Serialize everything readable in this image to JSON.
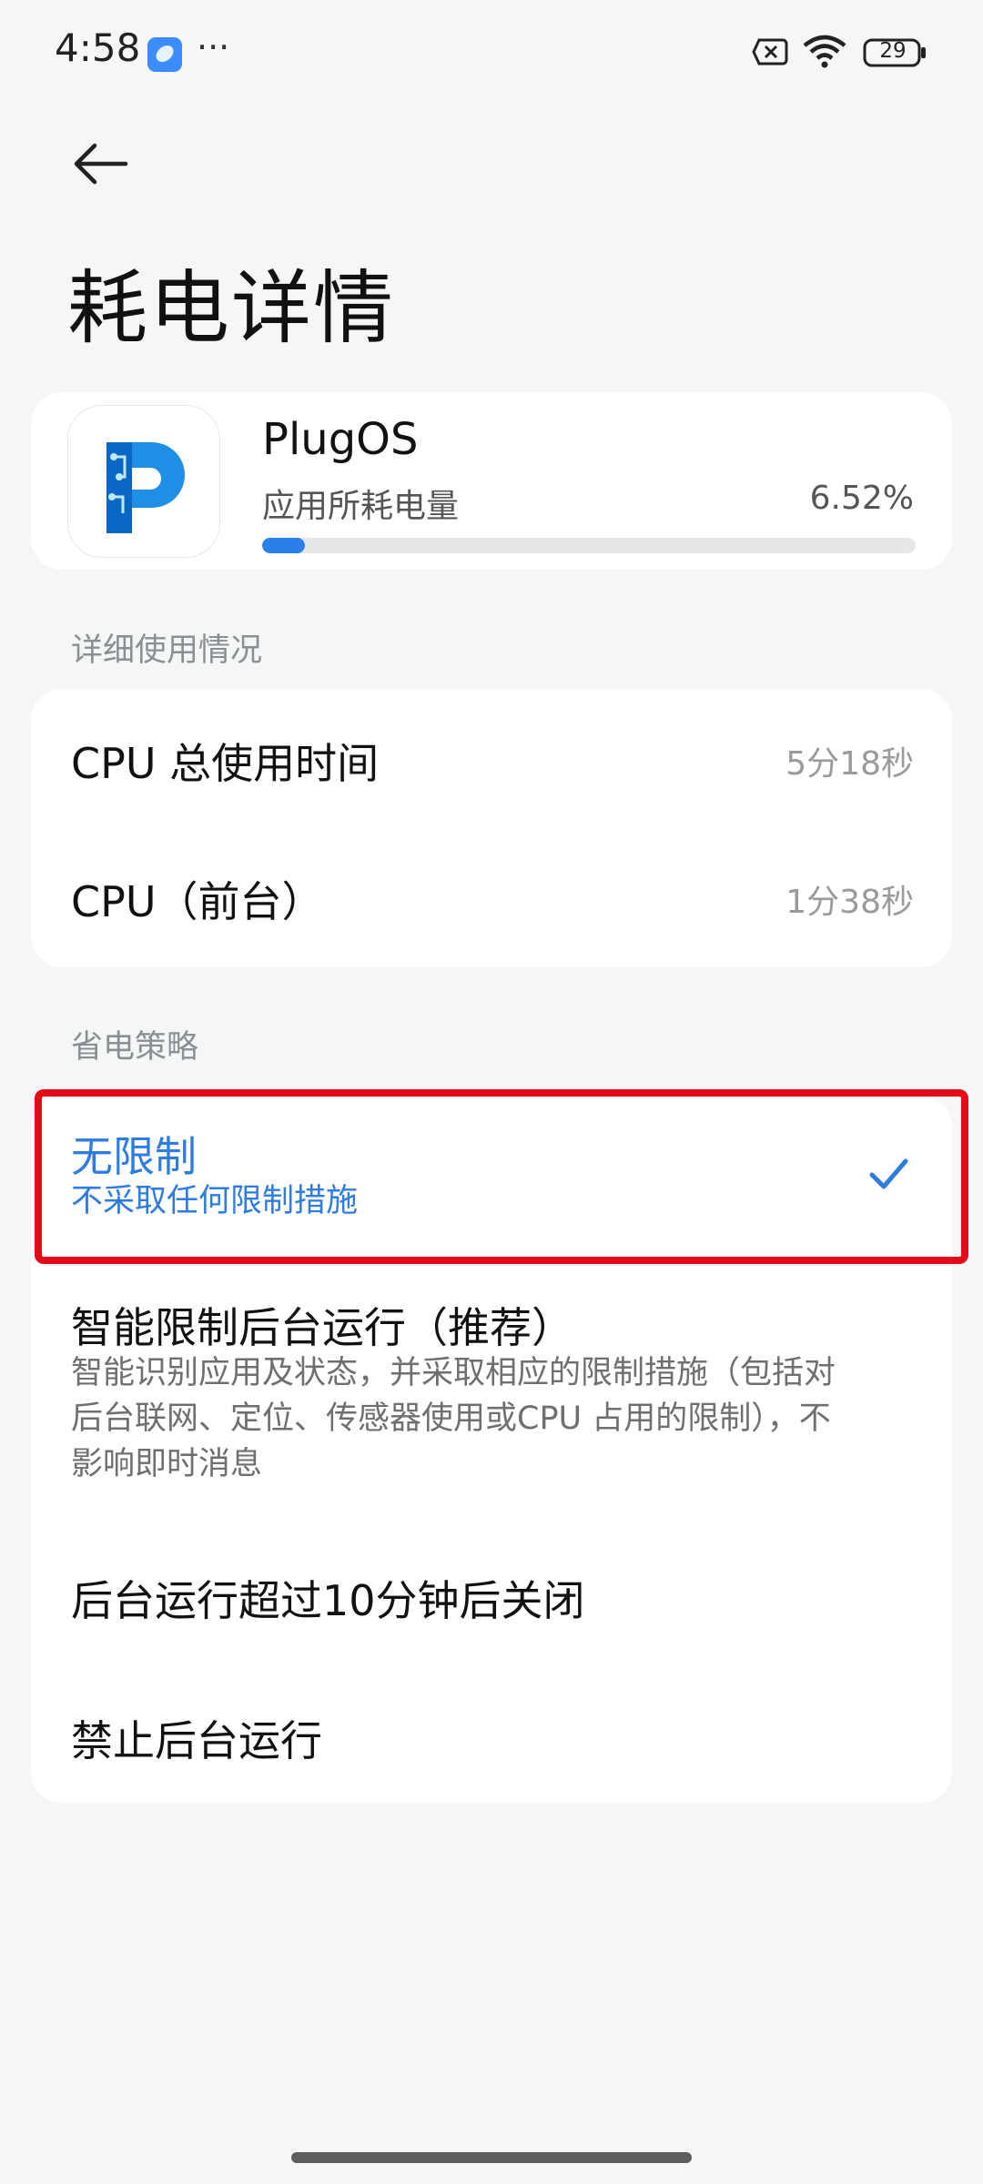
{
  "status_bar": {
    "time": "4:58",
    "dots": "···",
    "battery": "29"
  },
  "header": {
    "title": "耗电详情"
  },
  "app": {
    "name": "PlugOS",
    "usage_label": "应用所耗电量",
    "usage_percent": "6.52%",
    "usage_fraction": 0.0652,
    "accent_color": "#2a7fe8"
  },
  "usage": {
    "section_title": "详细使用情况",
    "rows": [
      {
        "label": "CPU 总使用时间",
        "value": "5分18秒"
      },
      {
        "label": "CPU（前台）",
        "value": "1分38秒"
      }
    ]
  },
  "policy": {
    "section_title": "省电策略",
    "options": [
      {
        "title": "无限制",
        "desc": "不采取任何限制措施",
        "selected": true
      },
      {
        "title": "智能限制后台运行（推荐）",
        "desc": "智能识别应用及状态，并采取相应的限制措施（包括对后台联网、定位、传感器使用或CPU 占用的限制），不影响即时消息"
      },
      {
        "title": "后台运行超过10分钟后关闭"
      },
      {
        "title": "禁止后台运行"
      }
    ],
    "selected_color": "#2f7ce0",
    "highlight_color": "#e30b17"
  },
  "icons": {
    "back": "back-arrow-icon",
    "check": "check-icon",
    "wifi": "wifi-icon",
    "sim": "no-sim-icon",
    "battery": "battery-icon",
    "app_notification": "app-notification-icon"
  }
}
